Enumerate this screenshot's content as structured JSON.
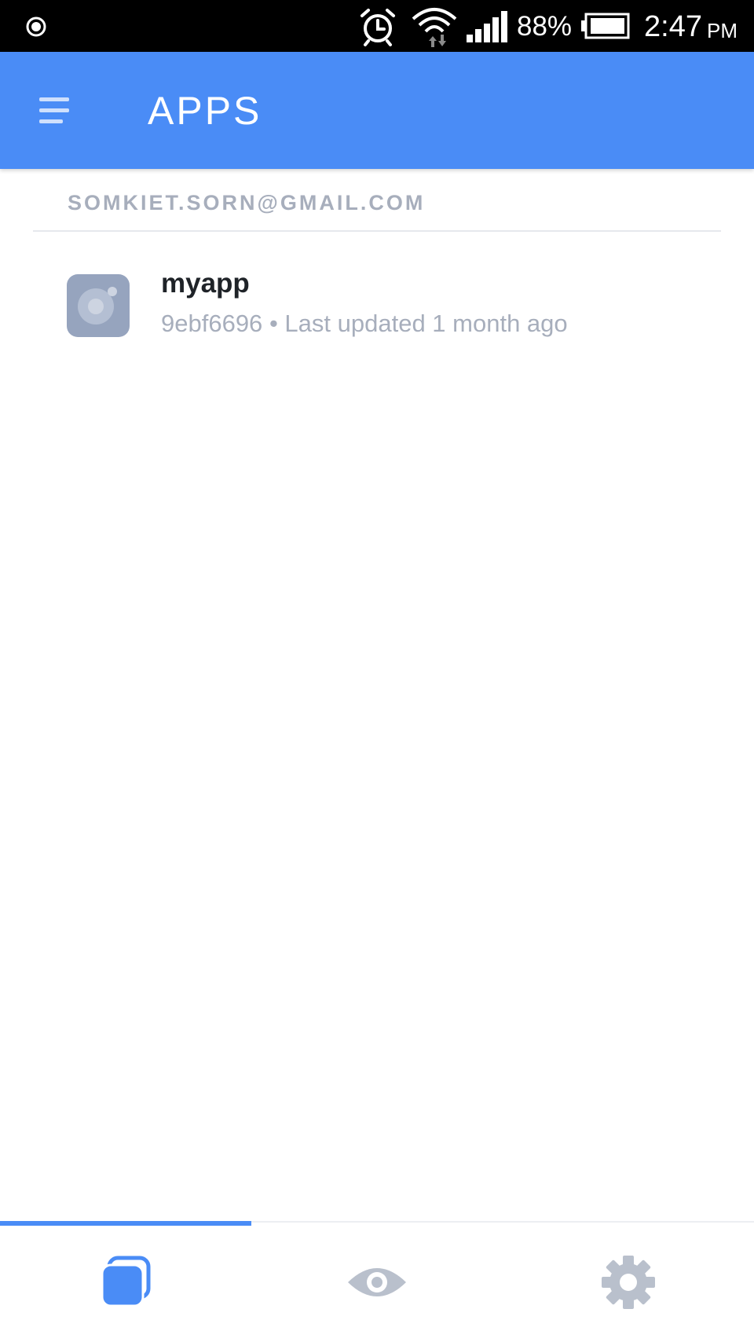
{
  "status_bar": {
    "battery_percent": "88%",
    "time": "2:47",
    "ampm": "PM",
    "icons": [
      "record-icon",
      "alarm-icon",
      "wifi-icon",
      "signal-icon",
      "battery-icon"
    ]
  },
  "app_bar": {
    "title": "APPS",
    "menu_icon": "menu-icon",
    "background_color": "#4a8cf6"
  },
  "account": {
    "email": "SOMKIET.SORN@GMAIL.COM"
  },
  "apps": [
    {
      "name": "myapp",
      "id": "9ebf6696",
      "separator": "•",
      "updated": "Last updated 1 month ago",
      "icon": "app-icon"
    }
  ],
  "bottom_nav": {
    "tabs": [
      {
        "icon": "apps-icon",
        "active": true
      },
      {
        "icon": "eye-icon",
        "active": false
      },
      {
        "icon": "gear-icon",
        "active": false
      }
    ],
    "active_color": "#4a8cf6",
    "inactive_color": "#b9c0cc"
  }
}
